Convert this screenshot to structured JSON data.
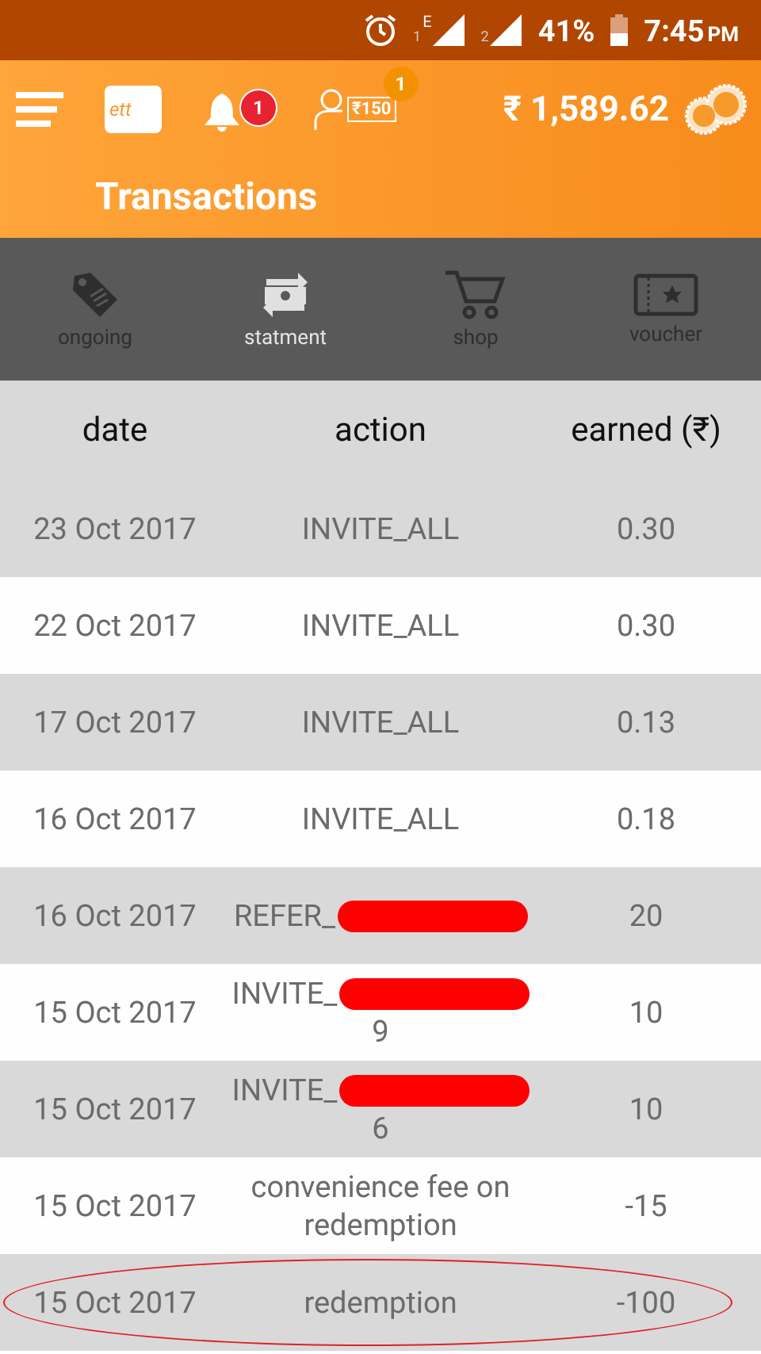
{
  "status_bar": {
    "sim1_label": "1",
    "network_type": "E",
    "sim2_label": "2",
    "battery": "41%",
    "time": "7:45",
    "ampm": "PM"
  },
  "toolbar": {
    "wallet_text": "ett",
    "notification_count": "1",
    "offer_amount": "₹150",
    "offer_count": "1",
    "balance": "₹ 1,589.62"
  },
  "title": "Transactions",
  "tabs": [
    {
      "label": "ongoing",
      "kind": "tag",
      "selected": false
    },
    {
      "label": "statment",
      "kind": "exchange",
      "selected": true
    },
    {
      "label": "shop",
      "kind": "cart",
      "selected": false
    },
    {
      "label": "voucher",
      "kind": "ticket",
      "selected": false
    }
  ],
  "table": {
    "columns": [
      "date",
      "action",
      "earned (₹)"
    ],
    "rows": [
      {
        "date": "23 Oct 2017",
        "action": "INVITE_ALL",
        "earned": "0.30",
        "redacted": false,
        "circled": false
      },
      {
        "date": "22 Oct 2017",
        "action": "INVITE_ALL",
        "earned": "0.30",
        "redacted": false,
        "circled": false
      },
      {
        "date": "17 Oct 2017",
        "action": "INVITE_ALL",
        "earned": "0.13",
        "redacted": false,
        "circled": false
      },
      {
        "date": "16 Oct 2017",
        "action": "INVITE_ALL",
        "earned": "0.18",
        "redacted": false,
        "circled": false
      },
      {
        "date": "16 Oct 2017",
        "action": "REFER_",
        "earned": "20",
        "redacted": true,
        "circled": false
      },
      {
        "date": "15 Oct 2017",
        "action": "INVITE_",
        "suffix": "9",
        "earned": "10",
        "redacted": true,
        "circled": false
      },
      {
        "date": "15 Oct 2017",
        "action": "INVITE_",
        "suffix": "6",
        "earned": "10",
        "redacted": true,
        "circled": false
      },
      {
        "date": "15 Oct 2017",
        "action": "convenience fee on redemption",
        "earned": "-15",
        "redacted": false,
        "circled": false
      },
      {
        "date": "15 Oct 2017",
        "action": "redemption",
        "earned": "-100",
        "redacted": false,
        "circled": true
      }
    ]
  }
}
